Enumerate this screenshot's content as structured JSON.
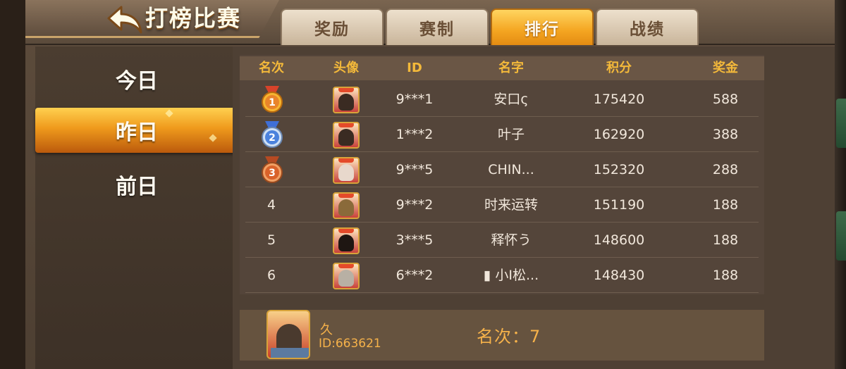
{
  "header": {
    "title": "打榜比赛",
    "tabs": [
      {
        "label": "奖励",
        "active": false
      },
      {
        "label": "赛制",
        "active": false
      },
      {
        "label": "排行",
        "active": true
      },
      {
        "label": "战绩",
        "active": false
      }
    ]
  },
  "sidebar": {
    "items": [
      {
        "label": "今日",
        "active": false
      },
      {
        "label": "昨日",
        "active": true
      },
      {
        "label": "前日",
        "active": false
      }
    ]
  },
  "table": {
    "headers": [
      "名次",
      "头像",
      "ID",
      "名字",
      "积分",
      "奖金"
    ],
    "rows": [
      {
        "rank": "1",
        "medal": "gold-medal-icon",
        "id": "9***1",
        "name": "安口ς",
        "score": "175420",
        "prize": "588"
      },
      {
        "rank": "2",
        "medal": "silver-medal-icon",
        "id": "1***2",
        "name": "叶子",
        "score": "162920",
        "prize": "388"
      },
      {
        "rank": "3",
        "medal": "bronze-medal-icon",
        "id": "9***5",
        "name": "CHIN...",
        "score": "152320",
        "prize": "288"
      },
      {
        "rank": "4",
        "medal": null,
        "id": "9***2",
        "name": "时来运转",
        "score": "151190",
        "prize": "188"
      },
      {
        "rank": "5",
        "medal": null,
        "id": "3***5",
        "name": "释怀う",
        "score": "148600",
        "prize": "188"
      },
      {
        "rank": "6",
        "medal": null,
        "id": "6***2",
        "name": "▮ 小I松...",
        "score": "148430",
        "prize": "188"
      }
    ]
  },
  "self": {
    "name": "久",
    "id": "ID:663621",
    "rank_text": "名次：7"
  },
  "colors": {
    "accent": "#f4a521",
    "header_text": "#f4b93a",
    "self_text": "#f6b24a",
    "cell_text": "#f1e7db"
  }
}
